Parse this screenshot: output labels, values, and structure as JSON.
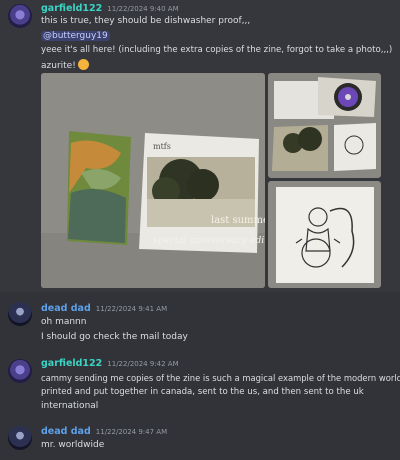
{
  "messages": [
    {
      "author": "garfield122",
      "author_color": "#3bd4c4",
      "timestamp": "11/22/2024 9:40 AM",
      "lines": [
        "this is true, they should be dishwasher proof,,,",
        "@butterguy19",
        "yeee it's all here! (including the extra copies of the zine, forgot to take a photo,,,)",
        "azurite!"
      ],
      "photo_text": {
        "cd_label": "mtfs",
        "cd_title": "last summe",
        "cd_subtitle": "special anniversary editio"
      }
    },
    {
      "author": "dead dad",
      "author_color": "#5ea0ea",
      "timestamp": "11/22/2024 9:41 AM",
      "lines": [
        "oh mannn",
        "I should go check the mail today"
      ]
    },
    {
      "author": "garfield122",
      "author_color": "#3bd4c4",
      "timestamp": "11/22/2024 9:42 AM",
      "lines": [
        "cammy sending me copies of the zine is such a magical example of the modern world",
        "printed and put together in canada, sent to the us, and then sent to the uk",
        "international"
      ]
    },
    {
      "author": "dead dad",
      "author_color": "#5ea0ea",
      "timestamp": "11/22/2024 9:47 AM",
      "lines": [
        "mr. worldwide"
      ]
    }
  ]
}
